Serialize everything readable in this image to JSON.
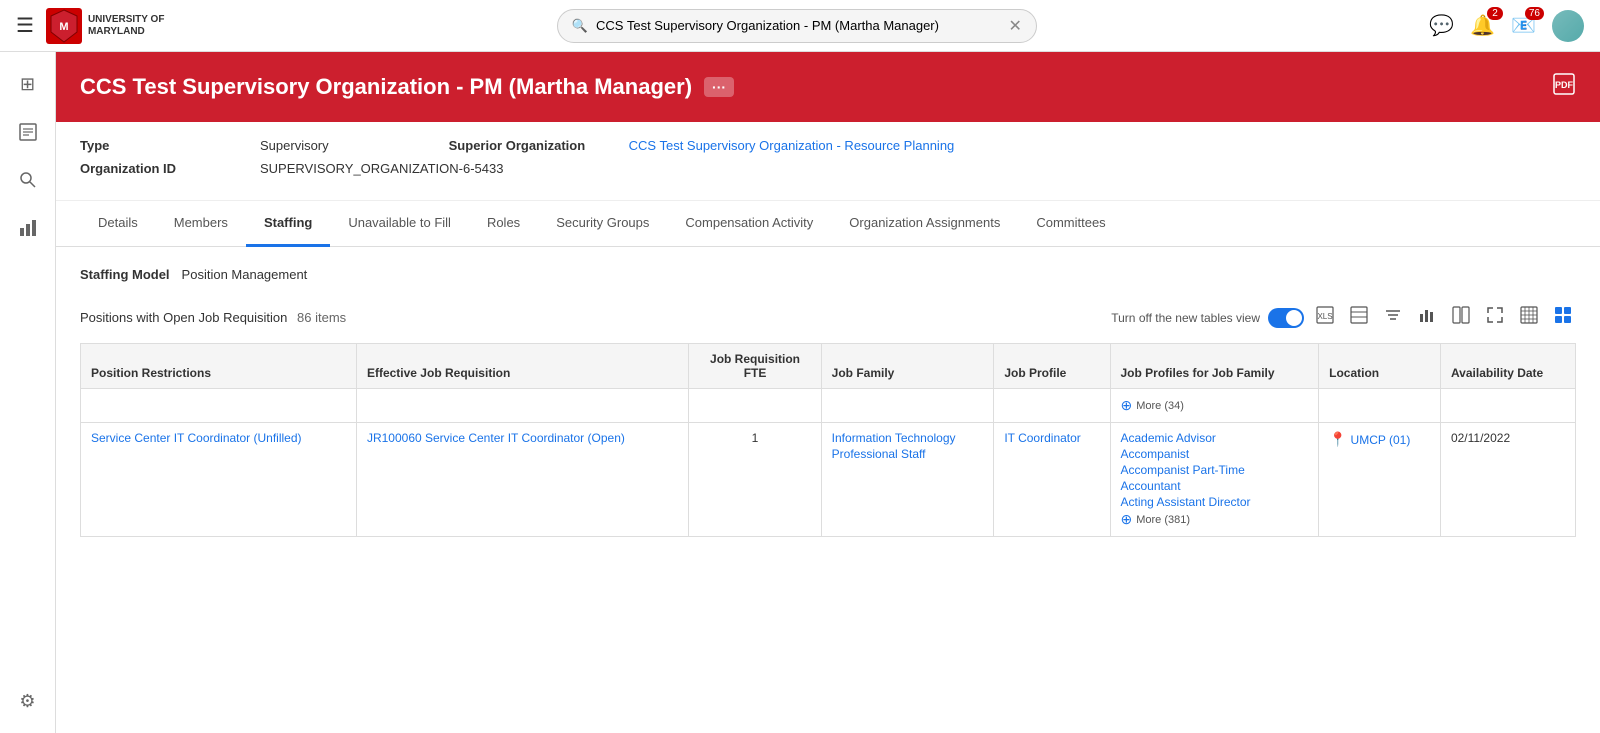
{
  "topnav": {
    "hamburger_label": "☰",
    "logo_initials": "M",
    "logo_text": "UNIVERSITY OF\nMARYLAND",
    "search_value": "CCS Test Supervisory Organization - PM (Martha Manager)",
    "search_clear": "✕",
    "notification_badge": "2",
    "mail_badge": "76",
    "chat_icon": "💬",
    "bell_icon": "🔔",
    "mail_icon": "📧"
  },
  "sidebar": {
    "icons": [
      {
        "name": "grid-icon",
        "symbol": "⊞",
        "label": "Dashboard"
      },
      {
        "name": "report-icon",
        "symbol": "📋",
        "label": "Reports"
      },
      {
        "name": "search-icon",
        "symbol": "🔍",
        "label": "Search"
      },
      {
        "name": "chart-icon",
        "symbol": "📊",
        "label": "Analytics"
      },
      {
        "name": "settings-icon",
        "symbol": "⚙",
        "label": "Settings"
      }
    ]
  },
  "header": {
    "title": "CCS Test Supervisory Organization - PM (Martha Manager)",
    "more_label": "···",
    "pdf_label": "⬚"
  },
  "info": {
    "type_label": "Type",
    "type_value": "Supervisory",
    "superior_org_label": "Superior Organization",
    "superior_org_link": "CCS Test Supervisory Organization - Resource Planning",
    "org_id_label": "Organization ID",
    "org_id_value": "SUPERVISORY_ORGANIZATION-6-5433"
  },
  "tabs": [
    {
      "id": "details",
      "label": "Details",
      "active": false
    },
    {
      "id": "members",
      "label": "Members",
      "active": false
    },
    {
      "id": "staffing",
      "label": "Staffing",
      "active": true
    },
    {
      "id": "unavailable",
      "label": "Unavailable to Fill",
      "active": false
    },
    {
      "id": "roles",
      "label": "Roles",
      "active": false
    },
    {
      "id": "security-groups",
      "label": "Security Groups",
      "active": false
    },
    {
      "id": "compensation",
      "label": "Compensation Activity",
      "active": false
    },
    {
      "id": "org-assignments",
      "label": "Organization Assignments",
      "active": false
    },
    {
      "id": "committees",
      "label": "Committees",
      "active": false
    }
  ],
  "staffing": {
    "model_label": "Staffing Model",
    "model_value": "Position Management",
    "toggle_label": "Turn off the new tables view",
    "table_title": "Positions with Open Job Requisition",
    "table_count": "86 items",
    "columns": [
      "Position Restrictions",
      "Effective Job Requisition",
      "Job Requisition FTE",
      "Job Family",
      "Job Profile",
      "Job Profiles for Job Family",
      "Location",
      "Availability Date"
    ],
    "pre_rows": [
      {
        "job_profiles_more": "More (34)"
      }
    ],
    "rows": [
      {
        "position_restriction": "Service Center IT Coordinator (Unfilled)",
        "effective_job_req": "JR100060 Service Center IT Coordinator (Open)",
        "fte": "1",
        "job_family_line1": "Information Technology",
        "job_family_line2": "Professional Staff",
        "job_profile": "IT Coordinator",
        "job_profiles": [
          "Academic Advisor",
          "Accompanist",
          "Accompanist Part-Time",
          "Accountant",
          "Acting Assistant Director"
        ],
        "job_profiles_more": "More (381)",
        "location": "UMCP (01)",
        "availability_date": "02/11/2022"
      }
    ]
  }
}
